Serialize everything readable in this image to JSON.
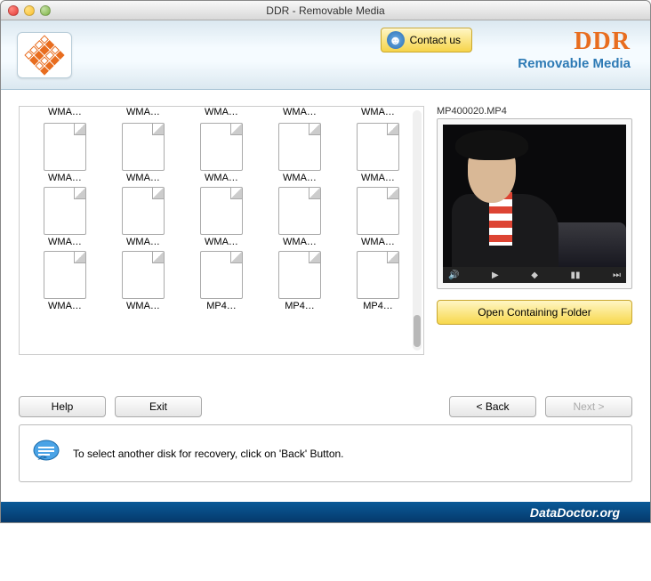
{
  "window": {
    "title": "DDR - Removable Media"
  },
  "header": {
    "contact_label": "Contact us",
    "brand_main": "DDR",
    "brand_sub": "Removable Media"
  },
  "files": {
    "toprow": [
      "WMA…",
      "WMA…",
      "WMA…",
      "WMA…",
      "WMA…"
    ],
    "items": [
      "WMA…",
      "WMA…",
      "WMA…",
      "WMA…",
      "WMA…",
      "WMA…",
      "WMA…",
      "WMA…",
      "WMA…",
      "WMA…",
      "WMA…",
      "WMA…",
      "MP4…",
      "MP4…",
      "MP4…"
    ]
  },
  "preview": {
    "filename": "MP400020.MP4",
    "open_folder_label": "Open Containing Folder"
  },
  "buttons": {
    "help": "Help",
    "exit": "Exit",
    "back": "< Back",
    "next": "Next >"
  },
  "hint": {
    "text": "To select another disk for recovery, click on 'Back' Button."
  },
  "footer": {
    "site": "DataDoctor.org"
  }
}
